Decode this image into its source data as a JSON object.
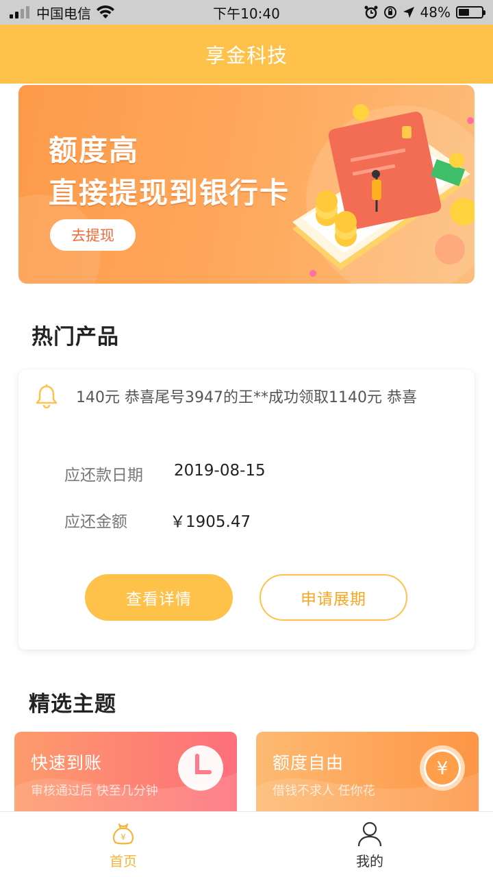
{
  "status_bar": {
    "carrier": "中国电信",
    "time": "下午10:40",
    "battery": "48%",
    "battery_level": 0.48
  },
  "header": {
    "title": "享金科技"
  },
  "banner": {
    "line1": "额度高",
    "line2": "直接提现到银行卡",
    "button": "去提现"
  },
  "hot_products": {
    "title": "热门产品",
    "notice": "140元 恭喜尾号3947的王**成功领取1140元 恭喜",
    "due_date_label": "应还款日期",
    "due_date": "2019-08-15",
    "amount_label": "应还金额",
    "amount": "￥1905.47",
    "detail_button": "查看详情",
    "extend_button": "申请展期"
  },
  "featured": {
    "title": "精选主题",
    "cards": [
      {
        "title": "快速到账",
        "subtitle": "审核通过后  快至几分钟",
        "icon": "clock-icon"
      },
      {
        "title": "额度自由",
        "subtitle": "借钱不求人  任你花",
        "icon": "yen-coin-icon"
      }
    ]
  },
  "tabbar": {
    "home": "首页",
    "mine": "我的"
  },
  "colors": {
    "brand": "#fec14a",
    "accent_text": "#f5a623"
  }
}
